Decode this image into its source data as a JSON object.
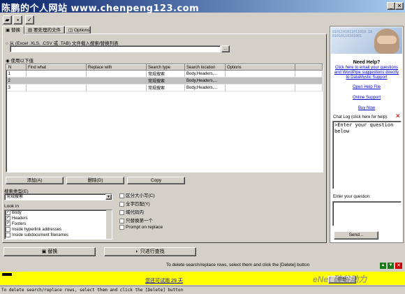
{
  "window": {
    "watermark": "陈鹏的个人网站  www.chenpeng123.com"
  },
  "toolbar": {
    "icons": [
      "open-folder-icon",
      "save-icon",
      "checklist-icon"
    ]
  },
  "tabs": [
    {
      "label": "替换",
      "icon": "replace-icon"
    },
    {
      "label": "要处理的文件",
      "icon": "files-icon"
    },
    {
      "label": "Options",
      "icon": "options-icon"
    }
  ],
  "source": {
    "file_option_label": "从 (Excel .XLS, .CSV 或 .TAB) 文件载入搜索/替换列表",
    "file_path": "",
    "use_values_label": "使用以下值"
  },
  "grid": {
    "columns": [
      "N",
      "Find what",
      "Replace with",
      "Search type",
      "Search location",
      "Options"
    ],
    "rows": [
      {
        "n": "1",
        "find": "",
        "replace": "",
        "type": "常规搜索",
        "location": "Body,Headers,...",
        "options": ""
      },
      {
        "n": "2",
        "find": "",
        "replace": "",
        "type": "常规搜索",
        "location": "Body,Headers,...",
        "options": ""
      },
      {
        "n": "3",
        "find": "",
        "replace": "",
        "type": "常规搜索",
        "location": "Body,Headers,...",
        "options": ""
      }
    ]
  },
  "grid_buttons": {
    "add": "添加(A)",
    "delete": "删除(D)",
    "copy": "Copy"
  },
  "search_type": {
    "label": "搜索类型(E)",
    "value": "常规搜索"
  },
  "look_in": {
    "label": "Look in",
    "items": [
      {
        "label": "Body",
        "checked": true
      },
      {
        "label": "Headers",
        "checked": true
      },
      {
        "label": "Footers",
        "checked": true
      },
      {
        "label": "Inside hyperlink addresses",
        "checked": false
      },
      {
        "label": "Inside subdocument filenames",
        "checked": false
      }
    ]
  },
  "options": [
    {
      "label": "区分大小写(C)",
      "checked": false
    },
    {
      "label": "全字匹配(Y)",
      "checked": false
    },
    {
      "label": "域代码内",
      "checked": false
    },
    {
      "label": "只替换第一个",
      "checked": false
    },
    {
      "label": "Prompt on replace",
      "checked": false
    }
  ],
  "actions": {
    "replace": "替换",
    "find_only": "只进行查找"
  },
  "status": {
    "hint": "To delete search/replace rows, select them and click the [Delete] button",
    "trial": "您还可试用 29 天",
    "help_btn": "帮助",
    "bottom_hint": "To delete search/replace rows, select them and click the [Delete] button"
  },
  "help": {
    "banner_digits": "0101101011011010 1001010110101001",
    "title": "Need Help?",
    "email_link": "Click here to email your questions and WordPipe suggestions directly to DataMystic Support",
    "help_file": "Open Help File",
    "online_support": "Online Support",
    "buy_now": "Buy Now",
    "chat_label": "Chat Log (click here for help):",
    "chat_text": ">Enter your question below",
    "question_label": "Enter your question:",
    "send": "Send..."
  },
  "logo": "eNet 硅谷动力"
}
